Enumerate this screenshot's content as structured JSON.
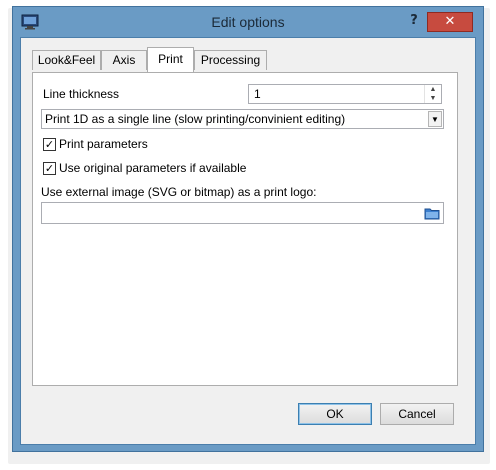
{
  "window": {
    "title": "Edit options",
    "help_label": "?",
    "close_label": "✕"
  },
  "tabs": [
    {
      "label": "Look&Feel",
      "active": false
    },
    {
      "label": "Axis",
      "active": false
    },
    {
      "label": "Print",
      "active": true
    },
    {
      "label": "Processing",
      "active": false
    }
  ],
  "print": {
    "line_thickness_label": "Line thickness",
    "line_thickness_value": "1",
    "print_mode_selected": "Print 1D as a single line (slow printing/convinient editing)",
    "print_parameters_label": "Print parameters",
    "print_parameters_checked": true,
    "use_original_label": "Use original parameters if available",
    "use_original_checked": true,
    "logo_label": "Use external image (SVG or bitmap) as a print logo:",
    "logo_value": ""
  },
  "buttons": {
    "ok_label": "OK",
    "cancel_label": "Cancel"
  },
  "icons": {
    "app": "monitor-icon",
    "browse": "folder-icon"
  },
  "colors": {
    "titlebar": "#6a9bc5",
    "close": "#c74b3f"
  }
}
